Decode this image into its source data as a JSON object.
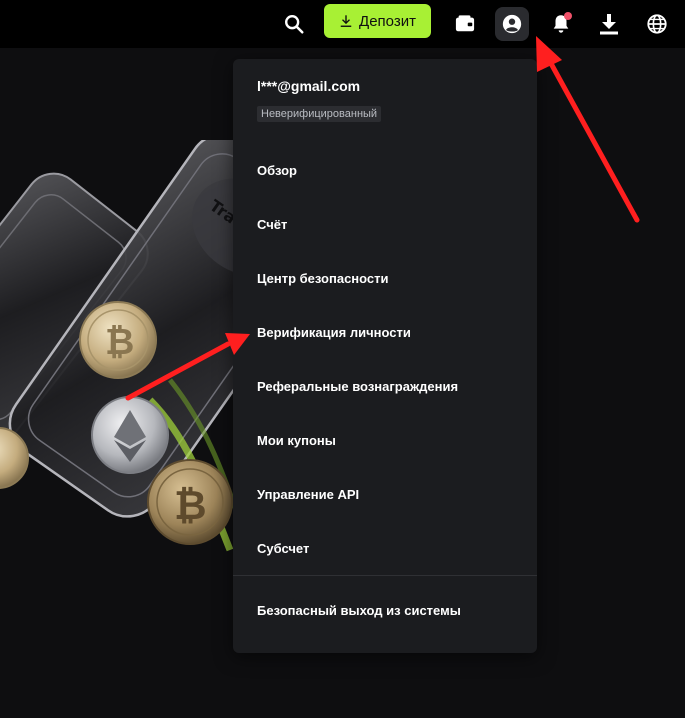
{
  "header": {
    "deposit_label": "Депозит",
    "icons": [
      "search-icon",
      "download-tray-icon",
      "wallet-icon",
      "user-account-icon",
      "bell-icon",
      "download-icon",
      "globe-icon"
    ]
  },
  "hero": {
    "card_text": "Trade with Tru"
  },
  "dropdown": {
    "email": "l***@gmail.com",
    "status_badge": "Неверифицированный",
    "items": [
      {
        "label": "Обзор"
      },
      {
        "label": "Счёт"
      },
      {
        "label": "Центр безопасности"
      },
      {
        "label": "Верификация личности"
      },
      {
        "label": "Реферальные вознаграждения"
      },
      {
        "label": "Мои купоны"
      },
      {
        "label": "Управление API"
      },
      {
        "label": "Субсчет"
      }
    ],
    "logout_label": "Безопасный выход из системы"
  },
  "colors": {
    "accent": "#a8f034",
    "annotation_arrow": "#ff1f1f",
    "notification_dot": "#f0526a",
    "menu_background": "#1b1c1f"
  }
}
